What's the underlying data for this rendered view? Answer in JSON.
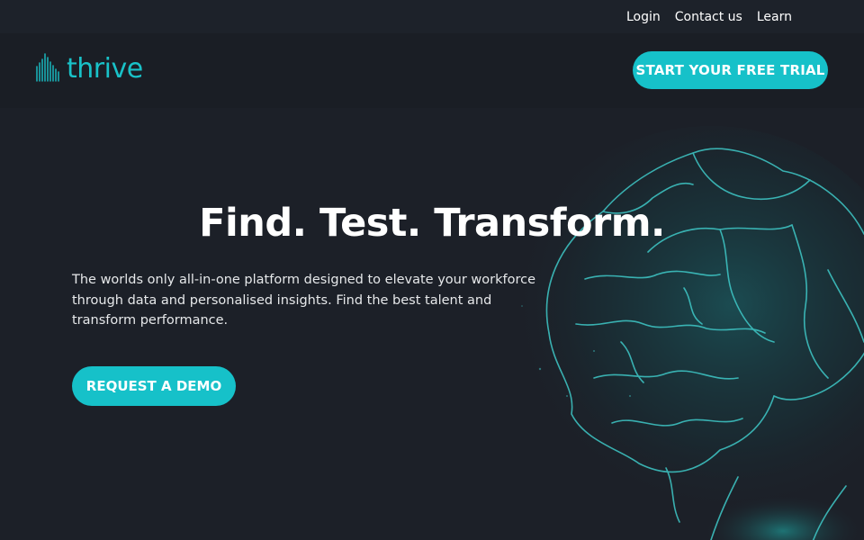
{
  "topnav": {
    "links": [
      "Login",
      "Contact us",
      "Learn"
    ]
  },
  "header": {
    "logo_text": "thrive",
    "trial_button": "START YOUR FREE TRIAL"
  },
  "hero": {
    "title": "Find. Test. Transform.",
    "subtitle": "The worlds only all-in-one platform designed to elevate your workforce through data and personalised insights. Find the best talent and transform performance.",
    "demo_button": "REQUEST A DEMO"
  },
  "colors": {
    "accent": "#16c1c9",
    "background": "#1c2028",
    "header_bg": "#1a1e25"
  },
  "icons": {
    "logo_mark": "sound-wave-icon",
    "hero_image": "brain-illustration"
  }
}
